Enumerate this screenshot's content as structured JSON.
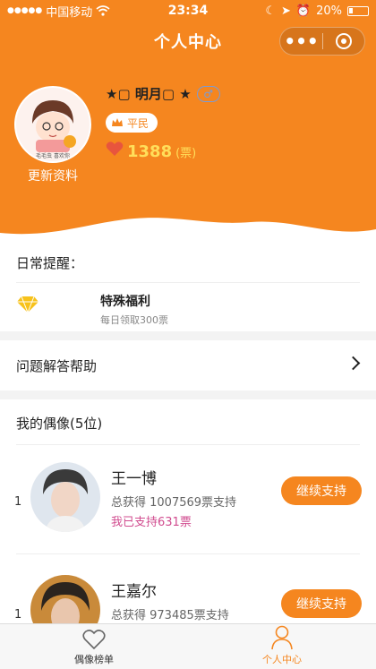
{
  "status_bar": {
    "carrier": "中国移动",
    "time": "23:34",
    "battery": "20%"
  },
  "nav": {
    "title": "个人中心",
    "more_icon": "more-dots-icon",
    "home_icon": "target-circle-icon"
  },
  "profile": {
    "username": "★▢ 明月▢ ★",
    "rank": "平民",
    "votes": "1388",
    "votes_unit": "(票)",
    "update_link": "更新资料",
    "avatar_text": "毛毛虫 喜欢你"
  },
  "reminder": {
    "title": "日常提醒：",
    "item_label": "特殊福利",
    "item_sub": "每日领取300票"
  },
  "help": {
    "label": "问题解答帮助"
  },
  "idols": {
    "title": "我的偶像(5位)",
    "items": [
      {
        "rank": "1",
        "name": "王一博",
        "total": "总获得 1007569票支持",
        "mine": "我已支持631票",
        "button": "继续支持"
      },
      {
        "rank": "1",
        "name": "王嘉尔",
        "total": "总获得 973485票支持",
        "mine": "",
        "button": "继续支持"
      }
    ]
  },
  "tabs": [
    {
      "label": "偶像榜单",
      "icon": "heart-outline-icon",
      "active": false
    },
    {
      "label": "个人中心",
      "icon": "person-outline-icon",
      "active": true
    }
  ],
  "colors": {
    "primary": "#f5861f",
    "vote": "#ffde5a",
    "supported": "#d14c8f"
  }
}
